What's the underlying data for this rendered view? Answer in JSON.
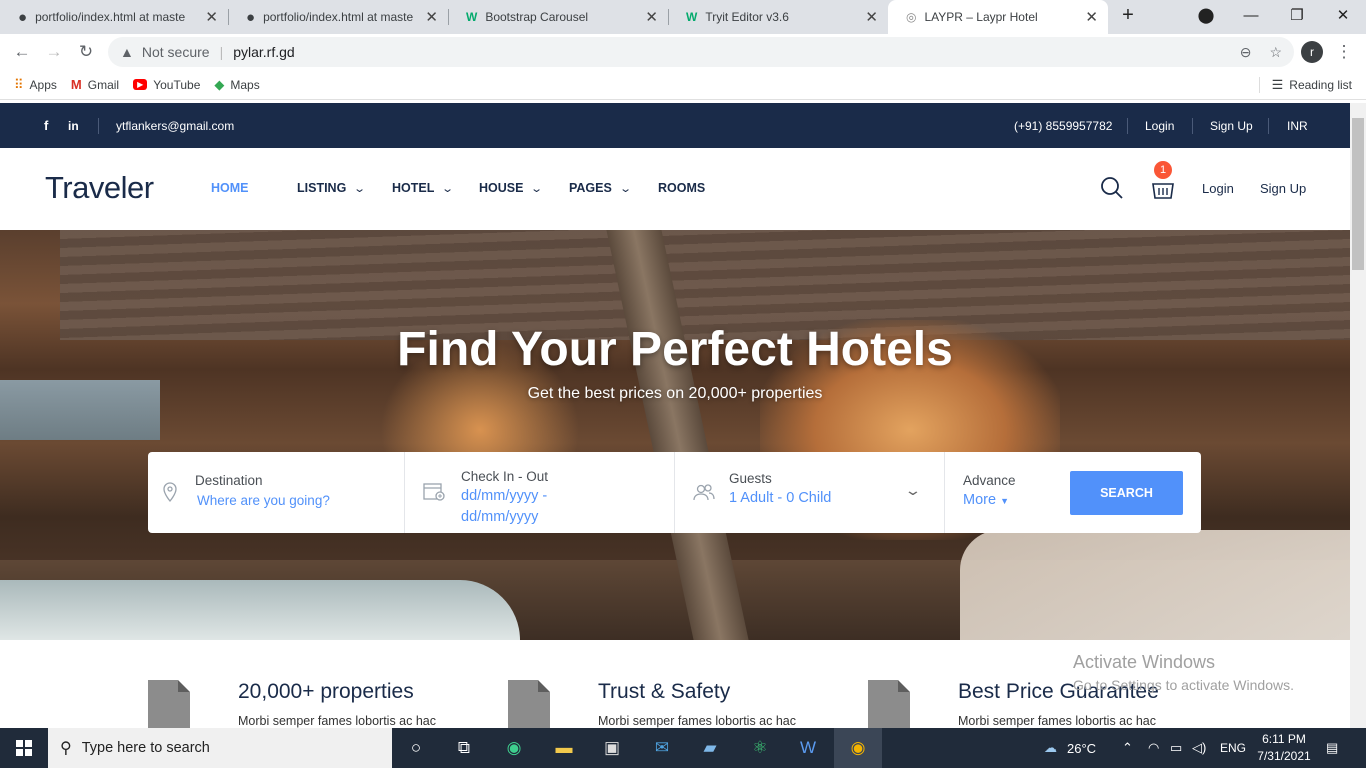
{
  "browser": {
    "tabs": [
      {
        "title": "portfolio/index.html at maste",
        "icon": "github-icon"
      },
      {
        "title": "portfolio/index.html at maste",
        "icon": "github-icon"
      },
      {
        "title": "Bootstrap Carousel",
        "icon": "w-logo-icon"
      },
      {
        "title": "Tryit Editor v3.6",
        "icon": "w-logo-icon"
      },
      {
        "title": "LAYPR – Laypr Hotel",
        "icon": "globe-icon",
        "active": true
      }
    ],
    "security": "Not secure",
    "url": "pylar.rf.gd",
    "profile_initial": "r",
    "bookmarks": [
      "Apps",
      "Gmail",
      "YouTube",
      "Maps"
    ],
    "reading_list": "Reading list"
  },
  "topbar": {
    "email": "ytflankers@gmail.com",
    "phone": "(+91) 8559957782",
    "login": "Login",
    "signup": "Sign Up",
    "currency": "INR"
  },
  "header": {
    "logo": "Traveler",
    "nav": [
      "HOME",
      "LISTING",
      "HOTEL",
      "HOUSE",
      "PAGES",
      "ROOMS"
    ],
    "cart_count": "1",
    "login": "Login",
    "signup": "Sign Up",
    "accent": "#5191fa"
  },
  "hero": {
    "title": "Find Your Perfect Hotels",
    "subtitle": "Get the best prices on 20,000+ properties"
  },
  "search": {
    "destination_label": "Destination",
    "destination_placeholder": "Where are you going?",
    "checkin_label": "Check In - Out",
    "checkin_value_1": "dd/mm/yyyy -",
    "checkin_value_2": "dd/mm/yyyy",
    "guests_label": "Guests",
    "guests_value": "1 Adult - 0 Child",
    "advance_label": "Advance",
    "more_label": "More",
    "button": "SEARCH"
  },
  "features": [
    {
      "title": "20,000+ properties",
      "desc": "Morbi semper fames lobortis ac hac"
    },
    {
      "title": "Trust & Safety",
      "desc": "Morbi semper fames lobortis ac hac"
    },
    {
      "title": "Best Price Guarantee",
      "desc": "Morbi semper fames lobortis ac hac"
    }
  ],
  "watermark": {
    "line1": "Activate Windows",
    "line2": "Go to Settings to activate Windows."
  },
  "taskbar": {
    "search_placeholder": "Type here to search",
    "weather": "26°C",
    "language": "ENG",
    "time": "6:11 PM",
    "date": "7/31/2021"
  }
}
